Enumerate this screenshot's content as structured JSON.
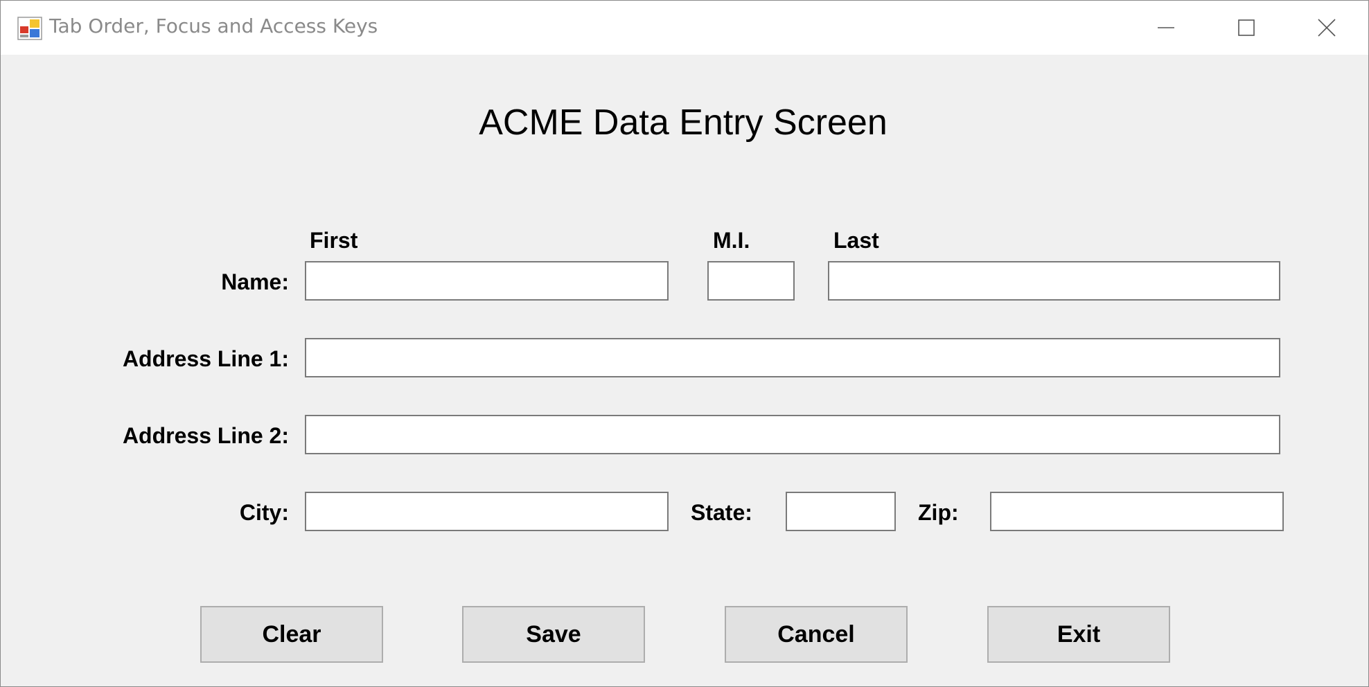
{
  "window": {
    "title": "Tab Order, Focus and Access Keys",
    "icon": "app-form-icon",
    "controls": {
      "minimize_icon": "minimize-icon",
      "maximize_icon": "maximize-icon",
      "close_icon": "close-icon"
    }
  },
  "form": {
    "heading": "ACME Data Entry Screen",
    "name": {
      "label": "Name:",
      "first_header": "First",
      "mi_header": "M.I.",
      "last_header": "Last",
      "first_value": "",
      "mi_value": "",
      "last_value": ""
    },
    "address1": {
      "label": "Address Line 1:",
      "value": ""
    },
    "address2": {
      "label": "Address Line 2:",
      "value": ""
    },
    "city": {
      "label": "City:",
      "value": ""
    },
    "state": {
      "label": "State:",
      "value": ""
    },
    "zip": {
      "label": "Zip:",
      "value": ""
    }
  },
  "buttons": {
    "clear": "Clear",
    "save": "Save",
    "cancel": "Cancel",
    "exit": "Exit"
  },
  "colors": {
    "form_background": "#f0f0f0",
    "titlebar_background": "#ffffff",
    "title_text": "#8a8a8a",
    "field_border": "#7a7a7a",
    "button_face": "#e1e1e1",
    "button_border": "#adadad"
  }
}
